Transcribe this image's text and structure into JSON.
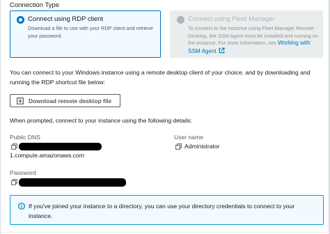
{
  "connection_type": {
    "label": "Connection Type",
    "options": [
      {
        "title": "Connect using RDP client",
        "description": "Download a file to use with your RDP client and retrieve your password.",
        "selected": true
      },
      {
        "title": "Connect using Fleet Manager",
        "description": "To connect to the instance using Fleet Manager Remote Desktop, the SSM Agent must be installed and running on the instance. For more information, see",
        "link_text": "Working with SSM Agent",
        "selected": false,
        "disabled": true
      }
    ]
  },
  "intro_text": "You can connect to your Windows instance using a remote desktop client of your choice, and by downloading and running the RDP shortcut file below:",
  "download_button_label": "Download remote desktop file",
  "details_intro": "When prompted, connect to your instance using the following details:",
  "public_dns": {
    "label": "Public DNS",
    "value_visible_suffix": "1.compute.amazonaws.com"
  },
  "user_name": {
    "label": "User name",
    "value": "Administrator"
  },
  "password": {
    "label": "Password"
  },
  "info_alert": {
    "text": "If you've joined your instance to a directory, you can use your directory credentials to connect to your instance."
  },
  "colors": {
    "accent": "#0073bb",
    "selected_tile_bg": "#f1faff",
    "disabled_tile_bg": "#eaeded",
    "info_border": "#00a1c9"
  },
  "icons": {
    "download": "download-icon",
    "copy": "copy-icon",
    "external": "external-link-icon",
    "info": "info-icon"
  }
}
